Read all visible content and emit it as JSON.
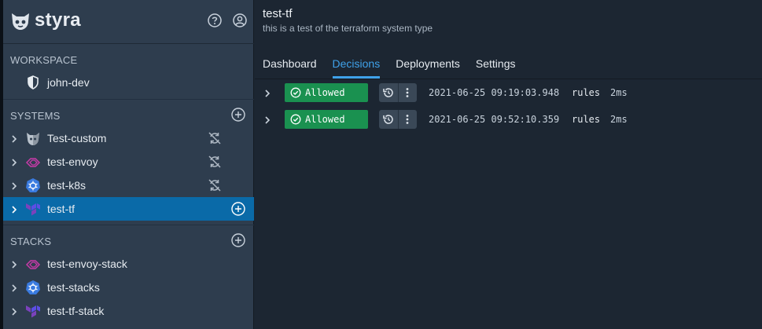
{
  "brand": {
    "name": "styra"
  },
  "header_icons": [
    "help-icon",
    "account-icon"
  ],
  "workspace": {
    "title": "WORKSPACE",
    "item": {
      "label": "john-dev",
      "icon": "shield-icon"
    }
  },
  "systems": {
    "title": "SYSTEMS",
    "items": [
      {
        "label": "Test-custom",
        "icon": "custom-system-icon",
        "status_icon": "disconnected-icon",
        "selected": false
      },
      {
        "label": "test-envoy",
        "icon": "envoy-icon",
        "status_icon": "disconnected-icon",
        "selected": false
      },
      {
        "label": "test-k8s",
        "icon": "kubernetes-icon",
        "status_icon": "disconnected-icon",
        "selected": false
      },
      {
        "label": "test-tf",
        "icon": "terraform-icon",
        "status_icon": "add-icon",
        "selected": true
      }
    ]
  },
  "stacks": {
    "title": "STACKS",
    "items": [
      {
        "label": "test-envoy-stack",
        "icon": "envoy-icon"
      },
      {
        "label": "test-stacks",
        "icon": "kubernetes-icon"
      },
      {
        "label": "test-tf-stack",
        "icon": "terraform-icon"
      }
    ]
  },
  "main": {
    "title": "test-tf",
    "subtitle": "this is a test of the terraform system type",
    "tabs": [
      {
        "label": "Dashboard",
        "active": false
      },
      {
        "label": "Decisions",
        "active": true
      },
      {
        "label": "Deployments",
        "active": false
      },
      {
        "label": "Settings",
        "active": false
      }
    ]
  },
  "decisions": [
    {
      "status": "Allowed",
      "timestamp": "2021-06-25 09:19:03.948",
      "path": "rules",
      "duration": "2ms"
    },
    {
      "status": "Allowed",
      "timestamp": "2021-06-25 09:52:10.359",
      "path": "rules",
      "duration": "2ms"
    }
  ],
  "colors": {
    "sidebar_bg": "#2e3d4e",
    "main_bg": "#1c2632",
    "selected_row": "#0a6aa8",
    "accent": "#3fa2ea",
    "allowed": "#1a9150"
  }
}
